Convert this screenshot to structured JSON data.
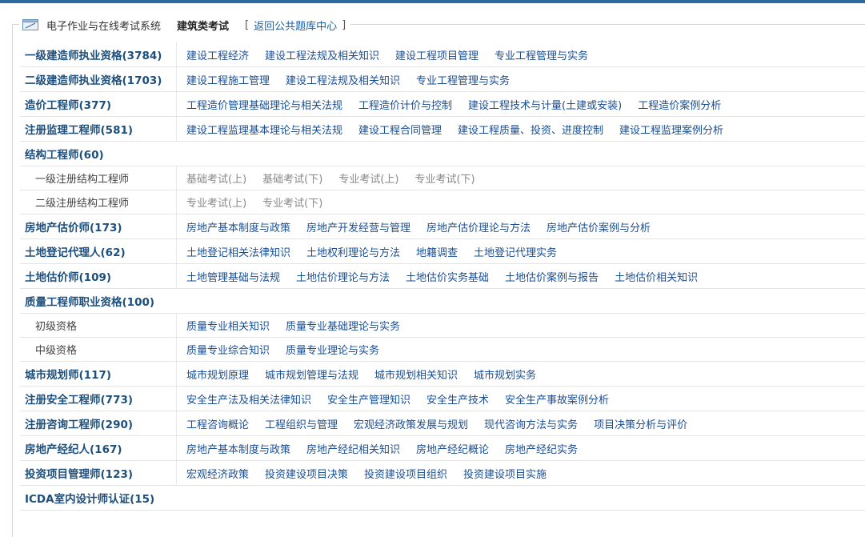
{
  "header": {
    "system_name": "电子作业与在线考试系统",
    "category": "建筑类考试",
    "bracket_open": "[",
    "back_link": "返回公共题库中心",
    "bracket_close": "]"
  },
  "rows": [
    {
      "title": "一级建造师执业资格(3784)",
      "links": [
        "建设工程经济",
        "建设工程法规及相关知识",
        "建设工程项目管理",
        "专业工程管理与实务"
      ]
    },
    {
      "title": "二级建造师执业资格(1703)",
      "links": [
        "建设工程施工管理",
        "建设工程法规及相关知识",
        "专业工程管理与实务"
      ]
    },
    {
      "title": "造价工程师(377)",
      "links": [
        "工程造价管理基础理论与相关法规",
        "工程造价计价与控制",
        "建设工程技术与计量(土建或安装)",
        "工程造价案例分析"
      ]
    },
    {
      "title": "注册监理工程师(581)",
      "links": [
        "建设工程监理基本理论与相关法规",
        "建设工程合同管理",
        "建设工程质量、投资、进度控制",
        "建设工程监理案例分析"
      ]
    },
    {
      "title": "结构工程师(60)",
      "links": []
    },
    {
      "subtitle": "一级注册结构工程师",
      "links": [
        "基础考试(上)",
        "基础考试(下)",
        "专业考试(上)",
        "专业考试(下)"
      ],
      "disabled": true
    },
    {
      "subtitle": "二级注册结构工程师",
      "links": [
        "专业考试(上)",
        "专业考试(下)"
      ],
      "disabled": true
    },
    {
      "title": "房地产估价师(173)",
      "links": [
        "房地产基本制度与政策",
        "房地产开发经营与管理",
        "房地产估价理论与方法",
        "房地产估价案例与分析"
      ]
    },
    {
      "title": "土地登记代理人(62)",
      "links": [
        "土地登记相关法律知识",
        "土地权利理论与方法",
        "地籍调查",
        "土地登记代理实务"
      ]
    },
    {
      "title": "土地估价师(109)",
      "links": [
        "土地管理基础与法规",
        "土地估价理论与方法",
        "土地估价实务基础",
        "土地估价案例与报告",
        "土地估价相关知识"
      ]
    },
    {
      "title": "质量工程师职业资格(100)",
      "links": []
    },
    {
      "subtitle": "初级资格",
      "links": [
        "质量专业相关知识",
        "质量专业基础理论与实务"
      ]
    },
    {
      "subtitle": "中级资格",
      "links": [
        "质量专业综合知识",
        "质量专业理论与实务"
      ]
    },
    {
      "title": "城市规划师(117)",
      "links": [
        "城市规划原理",
        "城市规划管理与法规",
        "城市规划相关知识",
        "城市规划实务"
      ]
    },
    {
      "title": "注册安全工程师(773)",
      "links": [
        "安全生产法及相关法律知识",
        "安全生产管理知识",
        "安全生产技术",
        "安全生产事故案例分析"
      ]
    },
    {
      "title": "注册咨询工程师(290)",
      "links": [
        "工程咨询概论",
        "工程组织与管理",
        "宏观经济政策发展与规划",
        "现代咨询方法与实务",
        "项目决策分析与评价"
      ]
    },
    {
      "title": "房地产经纪人(167)",
      "links": [
        "房地产基本制度与政策",
        "房地产经纪相关知识",
        "房地产经纪概论",
        "房地产经纪实务"
      ]
    },
    {
      "title": "投资项目管理师(123)",
      "links": [
        "宏观经济政策",
        "投资建设项目决策",
        "投资建设项目组织",
        "投资建设项目实施"
      ]
    },
    {
      "title": "ICDA室内设计师认证(15)",
      "links": []
    }
  ],
  "colors": {
    "top_bar": "#2c6aa0",
    "title": "#1d4f7c",
    "link": "#1a4e94",
    "disabled_link": "#888888"
  }
}
